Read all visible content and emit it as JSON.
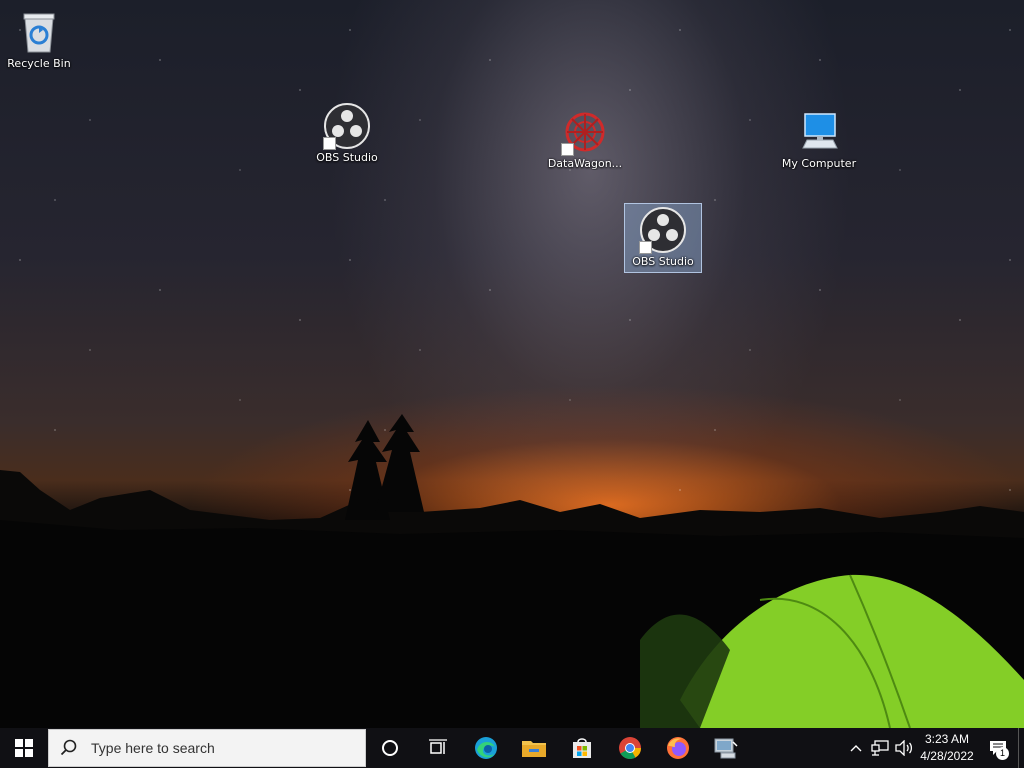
{
  "desktop": {
    "icons": [
      {
        "label": "Recycle Bin",
        "icon": "recycle-bin-icon"
      },
      {
        "label": "OBS Studio",
        "icon": "obs-studio-icon",
        "shortcut": true
      },
      {
        "label": "DataWagon...",
        "icon": "datawagon-icon",
        "shortcut": true
      },
      {
        "label": "My Computer",
        "icon": "computer-icon"
      },
      {
        "label": "OBS Studio",
        "icon": "obs-studio-icon",
        "shortcut": true,
        "selected": true
      }
    ]
  },
  "taskbar": {
    "search_placeholder": "Type here to search",
    "pinned": [
      "cortana-icon",
      "task-view-icon",
      "edge-icon",
      "file-explorer-icon",
      "microsoft-store-icon",
      "chrome-icon",
      "firefox-icon",
      "network-settings-icon"
    ],
    "tray": {
      "time": "3:23 AM",
      "date": "4/28/2022",
      "notification_count": "1"
    }
  },
  "colors": {
    "taskbar_bg": "#101014",
    "selection": "#8caad2",
    "tent_green": "#8fe02a"
  }
}
